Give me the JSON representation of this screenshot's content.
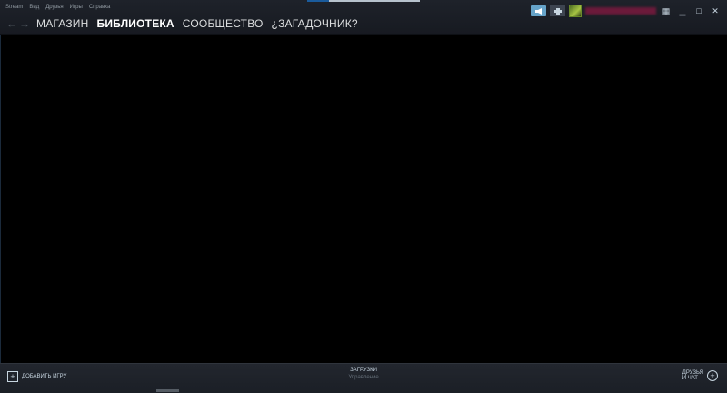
{
  "menubar": {
    "items": [
      "Stream",
      "Вид",
      "Друзья",
      "Игры",
      "Справка"
    ]
  },
  "nav": {
    "back_icon": "arrow-left-icon",
    "forward_icon": "arrow-right-icon",
    "links": [
      "МАГАЗИН",
      "БИБЛИОТЕКА",
      "СООБЩЕСТВО",
      "¿ЗАГАДОЧНИК?"
    ],
    "active": "БИБЛИОТЕКА"
  },
  "titlebar": {
    "notification_icon": "megaphone-icon",
    "print_icon": "printer-icon",
    "minimize": "▁",
    "maximize": "□",
    "close": "✕"
  },
  "bottom_bar": {
    "add_game_label": "ДОБАВИТЬ ИГРУ",
    "downloads_title": "ЗАГРУЗКИ",
    "downloads_subtitle": "Управление",
    "friends_line1": "ДРУЗЬЯ",
    "friends_line2": "И ЧАТ"
  },
  "colors": {
    "accent": "#66a3c8",
    "background": "#000000",
    "bar": "#171a21"
  }
}
